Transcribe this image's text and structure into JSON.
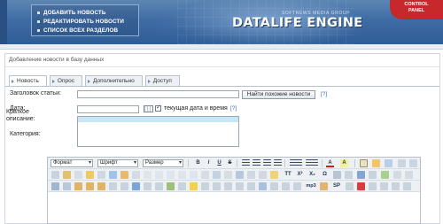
{
  "header": {
    "menu": [
      "ДОБАВИТЬ НОВОСТЬ",
      "РЕДАКТИРОВАТЬ НОВОСТИ",
      "СПИСОК ВСЕХ РАЗДЕЛОВ"
    ],
    "brand": "DATALIFE ENGINE",
    "tagline": "SOFTNEWS MEDIA GROUP",
    "control_panel": "CONTROL PANEL",
    "colors": {
      "header": "#3f6ca4",
      "badge": "#c7282c"
    }
  },
  "panel": {
    "title": "Добавление новости в базу данных",
    "tabs": [
      "Новость",
      "Опрос",
      "Дополнительно",
      "Доступ"
    ],
    "active_tab": "Новость"
  },
  "form": {
    "title_label": "Заголовок статьи:",
    "title_value": "",
    "similar_button": "Найти похожие новости",
    "help_mark": "[?]",
    "date_label": "Дата:",
    "date_value": "",
    "current_date_label": "текущая дата и время",
    "current_date_checked": true,
    "category_label": "Категория:",
    "short_label": "Краткое описание:"
  },
  "editor": {
    "format_select": "Формат",
    "font_select": "Шрифт",
    "size_select": "Размер",
    "row1_buttons": [
      "B",
      "I",
      "U",
      "S"
    ],
    "row3_text": [
      "TT",
      "X²",
      "X₂",
      "Ω",
      "mp3",
      "SP"
    ],
    "icons": [
      "bold",
      "italic",
      "underline",
      "strikethrough",
      "align-left",
      "align-center",
      "align-right",
      "justify",
      "bullet-list",
      "numbered-list",
      "font-color",
      "highlight",
      "undo",
      "redo"
    ]
  }
}
